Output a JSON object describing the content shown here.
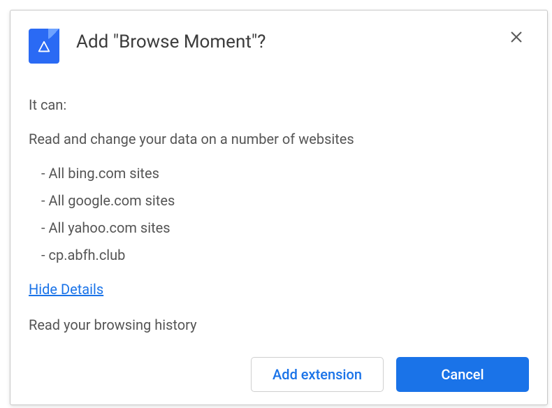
{
  "dialog": {
    "title": "Add \"Browse Moment\"?",
    "lead": "It can:",
    "permission_read_change": "Read and change your data on a number of websites",
    "sites": [
      "- All bing.com sites",
      "- All google.com sites",
      "- All yahoo.com sites",
      "- cp.abfh.club"
    ],
    "hide_details": "Hide Details",
    "permission_history": "Read your browsing history",
    "add_button": "Add extension",
    "cancel_button": "Cancel"
  }
}
